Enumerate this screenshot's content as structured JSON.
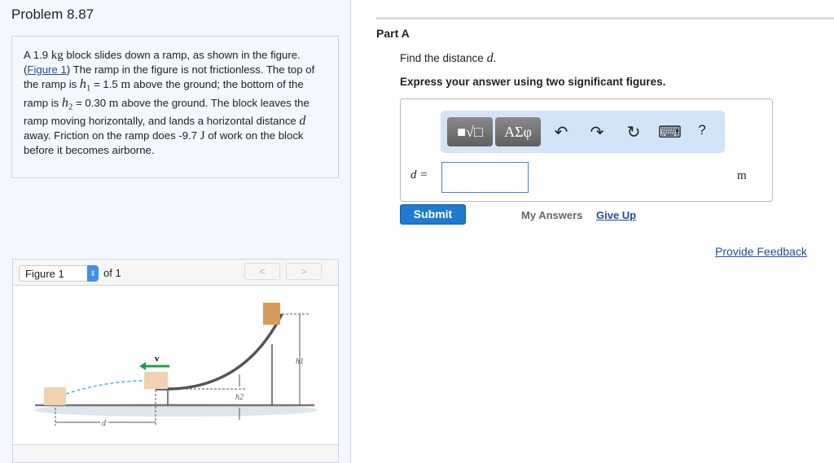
{
  "problem": {
    "title": "Problem 8.87",
    "text": {
      "p1": "A 1.9 ",
      "kg": "kg",
      "p2": " block slides down a ramp, as shown in the figure. (",
      "figlink": "Figure 1",
      "p3": ") The ramp in the figure is not frictionless. The top of the ramp is ",
      "h1": "h",
      "h1sub": "1",
      "p4": " = 1.5 ",
      "m1": "m",
      "p5": " above the ground; the bottom of the ramp is ",
      "h2": "h",
      "h2sub": "2",
      "p6": " = 0.30 ",
      "m2": "m",
      "p7": " above the ground. The block leaves the ramp moving horizontally, and lands a horizontal distance ",
      "d": "d",
      "p8": " away. Friction on the ramp does -9.7 ",
      "J": "J",
      "p9": " of work on the block before it becomes airborne."
    }
  },
  "figure": {
    "select": "Figure 1",
    "of": "of 1",
    "prev": "<",
    "next": ">",
    "labels": {
      "v": "v",
      "h1": "h1",
      "h2": "h2",
      "d": "d"
    }
  },
  "part": {
    "label": "Part A",
    "find": "Find the distance ",
    "find_var": "d",
    "find_end": ".",
    "instruction": "Express your answer using two significant figures.",
    "toolbar": {
      "templates": "■√□",
      "greek": "ΑΣφ",
      "undo": "↶",
      "redo": "↷",
      "reset": "↻",
      "keyboard": "⌨",
      "help": "?"
    },
    "var_label": "d =",
    "answer_value": "",
    "unit": "m"
  },
  "actions": {
    "submit": "Submit",
    "my_answers": "My Answers",
    "give_up": "Give Up",
    "feedback": "Provide Feedback"
  }
}
